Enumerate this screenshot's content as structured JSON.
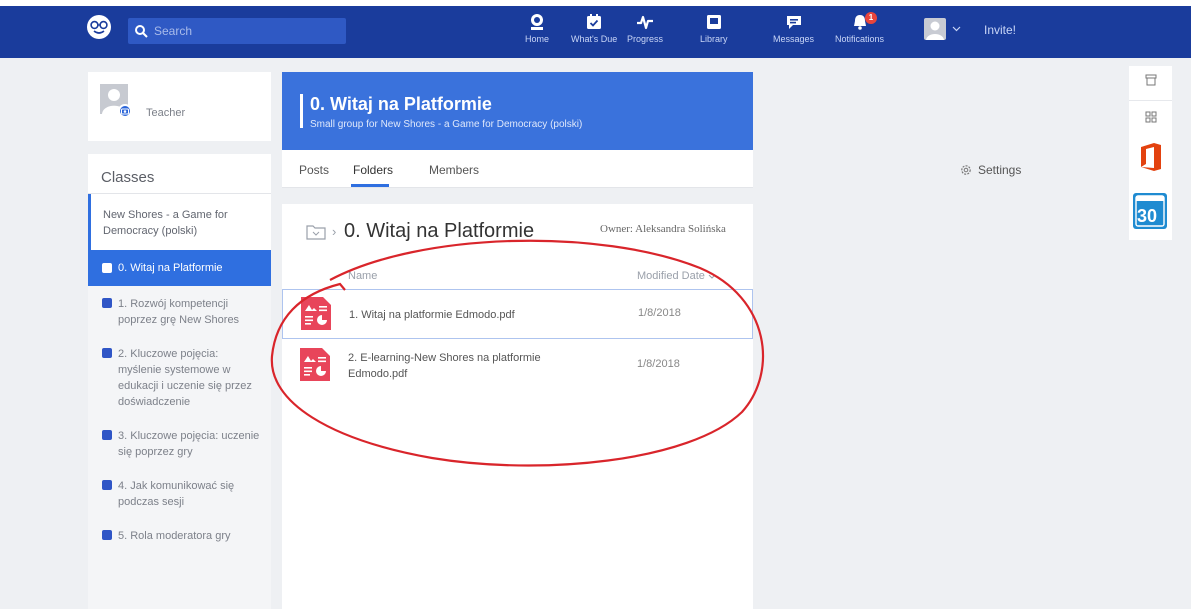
{
  "topbar": {
    "search_placeholder": "Search",
    "nav": [
      {
        "label": "Home",
        "icon": "home-icon"
      },
      {
        "label": "What's Due",
        "icon": "calendar-check-icon"
      },
      {
        "label": "Progress",
        "icon": "pulse-icon"
      },
      {
        "label": "Library",
        "icon": "library-icon"
      },
      {
        "label": "Messages",
        "icon": "chat-icon"
      },
      {
        "label": "Notifications",
        "icon": "bell-icon"
      }
    ],
    "notification_count": "1",
    "invite_label": "Invite!"
  },
  "profile": {
    "role": "Teacher"
  },
  "classes": {
    "title": "Classes",
    "group": "New Shores - a Game for Democracy (polski)",
    "items": [
      {
        "label": "0. Witaj na Platformie"
      },
      {
        "label": "1. Rozwój kompetencji poprzez grę New Shores"
      },
      {
        "label": "2. Kluczowe pojęcia: myślenie systemowe w edukacji i uczenie się przez doświadczenie"
      },
      {
        "label": "3. Kluczowe pojęcia: uczenie się poprzez gry"
      },
      {
        "label": "4. Jak komunikować się podczas sesji"
      },
      {
        "label": "5. Rola moderatora gry"
      }
    ]
  },
  "group": {
    "title": "0. Witaj na Platformie",
    "subtitle": "Small group for New Shores - a Game for Democracy (polski)"
  },
  "tabs": {
    "posts": "Posts",
    "folders": "Folders",
    "members": "Members",
    "settings": "Settings"
  },
  "folder": {
    "title": "0. Witaj na Platformie",
    "owner": "Owner: Aleksandra Solińska",
    "col_name": "Name",
    "col_date": "Modified Date",
    "files": [
      {
        "name": "1. Witaj na platformie Edmodo.pdf",
        "date": "1/8/2018"
      },
      {
        "name": "2. E-learning-New Shores na platformie Edmodo.pdf",
        "date": "1/8/2018"
      }
    ]
  },
  "rail": {
    "calendar_day": "30"
  },
  "colors": {
    "topbar": "#1a3c9c",
    "accent": "#2f6fe0",
    "annotation": "#d9252b",
    "file_icon": "#e8455a"
  }
}
